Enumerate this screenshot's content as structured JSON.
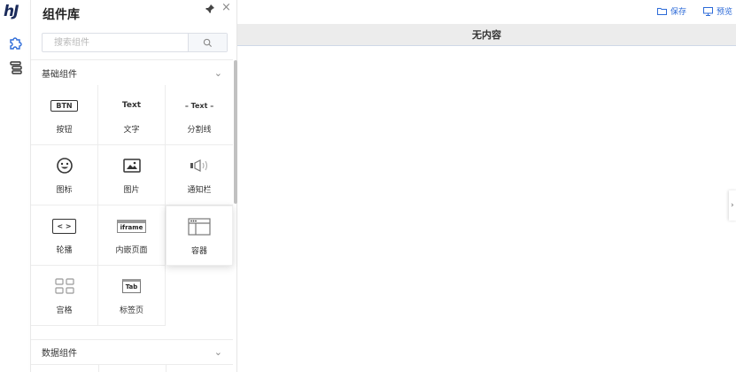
{
  "app": {
    "logo": "hJ"
  },
  "panel": {
    "title": "组件库",
    "search_placeholder": "搜索组件",
    "sections": [
      {
        "label": "基础组件",
        "expanded": true
      },
      {
        "label": "数据组件",
        "expanded": false
      }
    ],
    "components": [
      {
        "label": "按钮",
        "icon": "button-icon",
        "icon_text": "BTN"
      },
      {
        "label": "文字",
        "icon": "text-icon",
        "icon_text": "Text"
      },
      {
        "label": "分割线",
        "icon": "divider-icon",
        "icon_text": "– Text –"
      },
      {
        "label": "图标",
        "icon": "smiley-icon"
      },
      {
        "label": "图片",
        "icon": "image-icon"
      },
      {
        "label": "通知栏",
        "icon": "speaker-icon"
      },
      {
        "label": "轮播",
        "icon": "carousel-icon",
        "icon_text": "< >"
      },
      {
        "label": "内嵌页面",
        "icon": "iframe-icon",
        "icon_text": "iframe"
      },
      {
        "label": "容器",
        "icon": "container-icon"
      },
      {
        "label": "宫格",
        "icon": "grid-icon"
      },
      {
        "label": "标签页",
        "icon": "tab-icon",
        "icon_text": "Tab"
      }
    ]
  },
  "toolbar": {
    "save_label": "保存",
    "preview_label": "预览"
  },
  "canvas": {
    "header": "无内容"
  },
  "colors": {
    "accent": "#2d6bd8",
    "header_bg": "#ececec"
  }
}
